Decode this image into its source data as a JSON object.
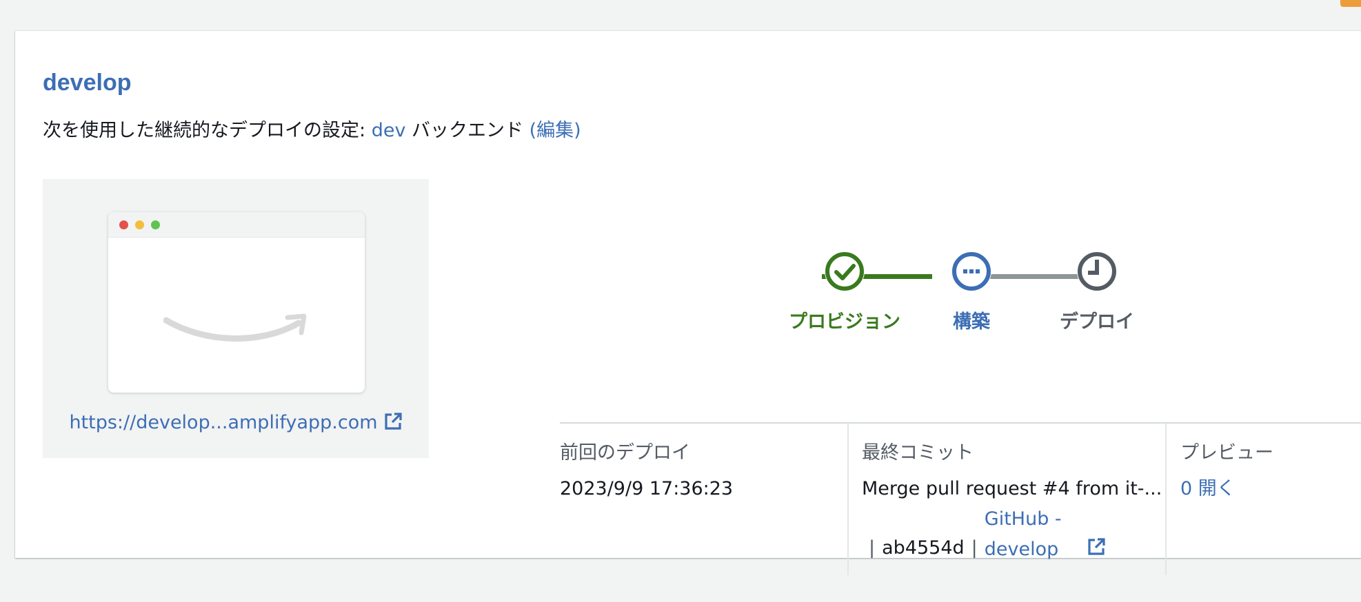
{
  "branch": {
    "title": "develop",
    "subtitle_prefix": "次を使用した継続的なデプロイの設定:",
    "backend_link": "dev",
    "backend_suffix": "バックエンド",
    "edit_link": "(編集)"
  },
  "preview": {
    "url": "https://develop...amplifyapp.com"
  },
  "stepper": {
    "steps": [
      {
        "label": "プロビジョン",
        "status": "complete",
        "color": "#3a7a1f"
      },
      {
        "label": "構築",
        "status": "in-progress",
        "color": "#3c6eb4"
      },
      {
        "label": "デプロイ",
        "status": "pending",
        "color": "#545b64"
      }
    ]
  },
  "info": {
    "last_deploy_label": "前回のデプロイ",
    "last_deploy_value": "2023/9/9 17:36:23",
    "last_commit_label": "最終コミット",
    "commit_message": "Merge pull request #4 from it-...",
    "commit_hash": "ab4554d",
    "commit_source": "GitHub - develop",
    "preview_label": "プレビュー",
    "preview_value": "0 開く"
  },
  "colors": {
    "link": "#3c6eb4",
    "success": "#3a7a1f",
    "pending": "#545b64",
    "accent": "#ec9c3a"
  }
}
